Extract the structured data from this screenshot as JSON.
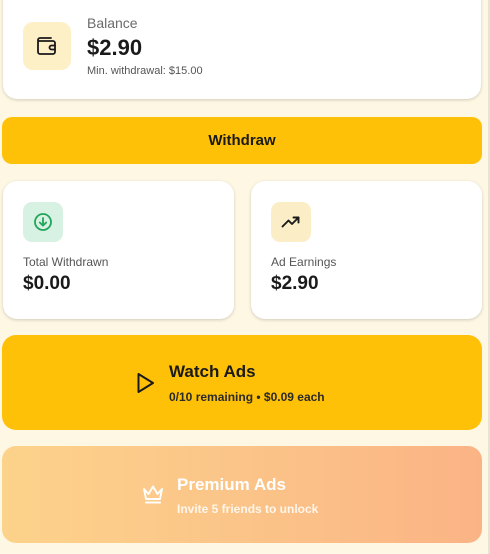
{
  "balance": {
    "label": "Balance",
    "amount": "$2.90",
    "min_withdrawal": "Min. withdrawal: $15.00",
    "icon": "wallet-icon"
  },
  "withdraw": {
    "label": "Withdraw"
  },
  "stats": [
    {
      "label": "Total Withdrawn",
      "value": "$0.00",
      "icon": "download-circle-icon"
    },
    {
      "label": "Ad Earnings",
      "value": "$2.90",
      "icon": "trending-up-icon"
    }
  ],
  "watch_ads": {
    "title": "Watch Ads",
    "subtitle": "0/10 remaining • $0.09 each",
    "icon": "play-icon"
  },
  "premium_ads": {
    "title": "Premium Ads",
    "subtitle": "Invite 5 friends to unlock",
    "icon": "crown-icon"
  },
  "colors": {
    "background": "#fdf7e3",
    "accent": "#ffc107",
    "green_icon": "#22a45a",
    "premium_gradient_start": "#fcd38b",
    "premium_gradient_end": "#fbb385"
  }
}
